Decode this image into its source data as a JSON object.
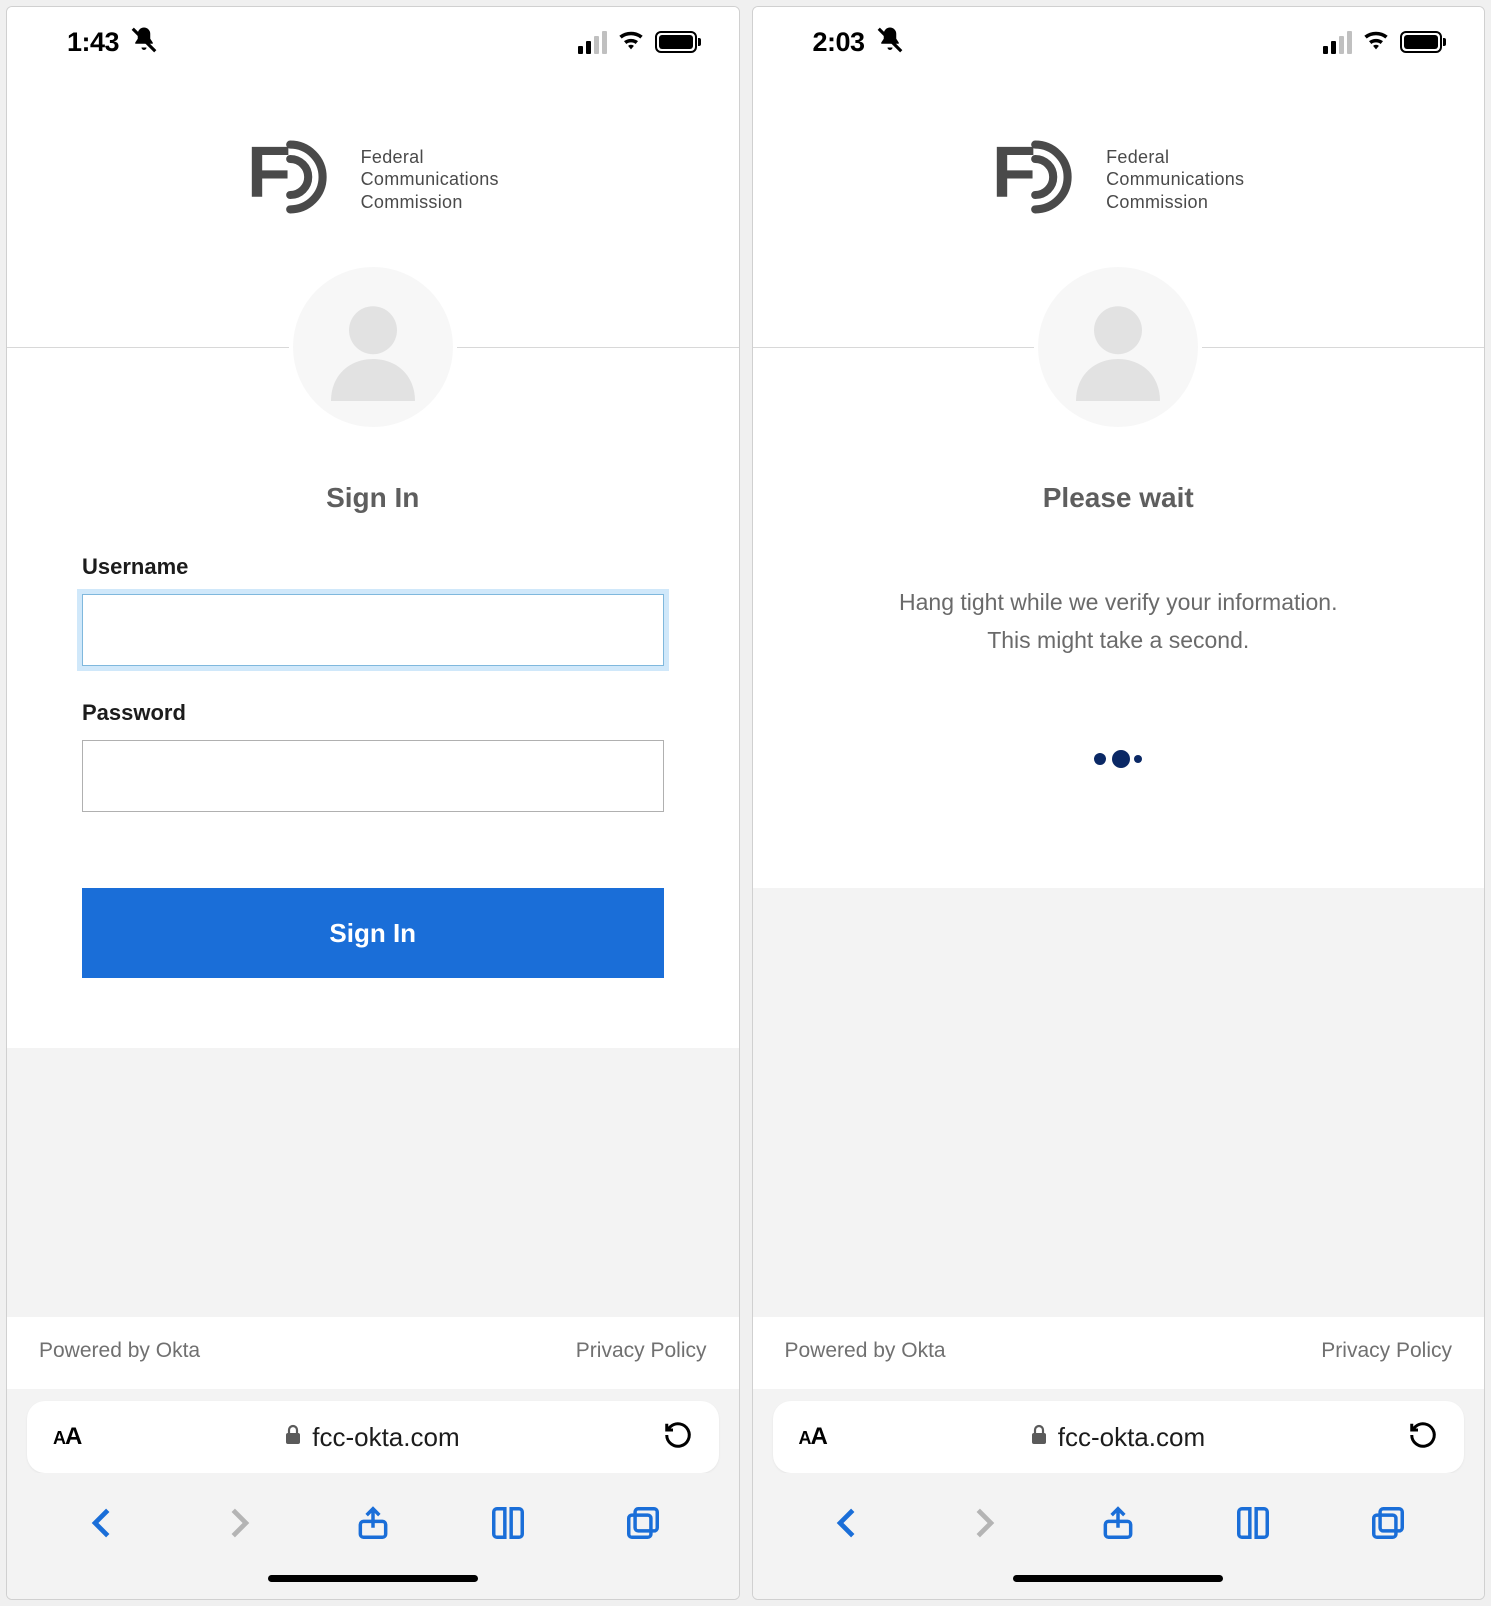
{
  "left": {
    "status": {
      "time": "1:43"
    },
    "brand": {
      "line1": "Federal",
      "line2": "Communications",
      "line3": "Commission"
    },
    "heading": "Sign In",
    "form": {
      "username_label": "Username",
      "password_label": "Password",
      "submit_label": "Sign In"
    },
    "footer": {
      "powered": "Powered by Okta",
      "privacy": "Privacy Policy"
    },
    "urlbar": {
      "domain": "fcc-okta.com"
    }
  },
  "right": {
    "status": {
      "time": "2:03"
    },
    "brand": {
      "line1": "Federal",
      "line2": "Communications",
      "line3": "Commission"
    },
    "heading": "Please wait",
    "message": {
      "line1": "Hang tight while we verify your information.",
      "line2": "This might take a second."
    },
    "footer": {
      "powered": "Powered by Okta",
      "privacy": "Privacy Policy"
    },
    "urlbar": {
      "domain": "fcc-okta.com"
    }
  }
}
